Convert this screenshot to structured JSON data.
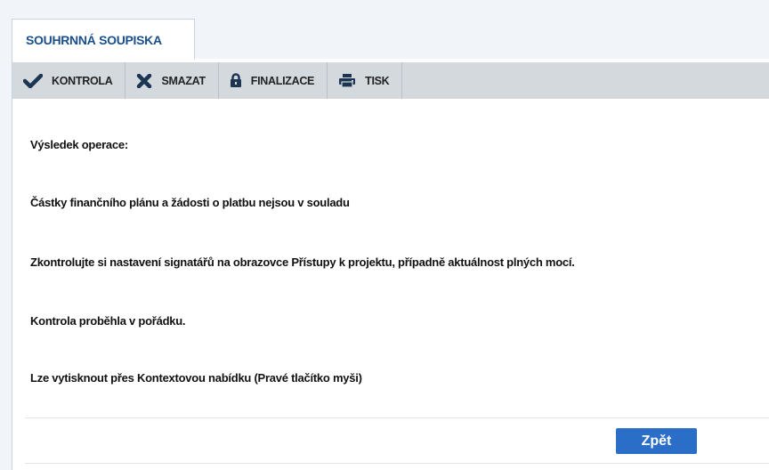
{
  "tab": {
    "title": "SOUHRNNÁ SOUPISKA"
  },
  "toolbar": {
    "buttons": [
      {
        "label": "KONTROLA",
        "icon": "checkmark-icon"
      },
      {
        "label": "SMAZAT",
        "icon": "x-icon"
      },
      {
        "label": "FINALIZACE",
        "icon": "lock-icon"
      },
      {
        "label": "TISK",
        "icon": "printer-icon"
      }
    ]
  },
  "messages": [
    "Výsledek operace:",
    "Částky finančního plánu a žádosti o platbu nejsou v souladu",
    "Zkontrolujte si nastavení signatářů na obrazovce Přístupy k projektu, případně aktuálnost plných mocí.",
    "Kontrola proběhla v pořádku.",
    "Lze vytisknout přes Kontextovou nabídku (Pravé tlačítko myši)"
  ],
  "footer": {
    "back_label": "Zpět"
  },
  "colors": {
    "tab_text": "#1b4f8c",
    "toolbar_bg": "#d4d9de",
    "button_bg": "#2a6ec7"
  }
}
